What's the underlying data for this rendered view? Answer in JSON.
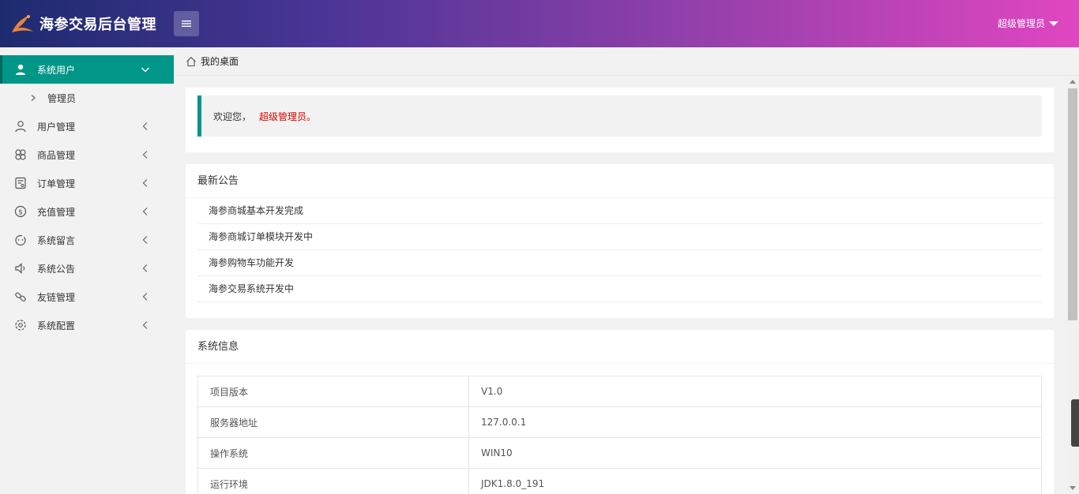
{
  "header": {
    "title": "海参交易后台管理",
    "user_menu": "超级管理员"
  },
  "sidebar": {
    "items": [
      {
        "label": "系统用户",
        "icon": "user-icon",
        "expanded": true,
        "sub": [
          "管理员"
        ]
      },
      {
        "label": "用户管理",
        "icon": "user-outline-icon"
      },
      {
        "label": "商品管理",
        "icon": "product-icon"
      },
      {
        "label": "订单管理",
        "icon": "order-icon"
      },
      {
        "label": "充值管理",
        "icon": "dollar-icon"
      },
      {
        "label": "系统留言",
        "icon": "message-icon"
      },
      {
        "label": "系统公告",
        "icon": "speaker-icon"
      },
      {
        "label": "友链管理",
        "icon": "link-icon"
      },
      {
        "label": "系统配置",
        "icon": "settings-icon"
      }
    ]
  },
  "breadcrumb": {
    "label": "我的桌面"
  },
  "welcome": {
    "text": "欢迎您，",
    "admin": "超级管理员。"
  },
  "notice": {
    "title": "最新公告",
    "items": [
      "海参商城基本开发完成",
      "海参商城订单模块开发中",
      "海参购物车功能开发",
      "海参交易系统开发中"
    ]
  },
  "sysinfo": {
    "title": "系统信息",
    "rows": [
      {
        "key": "项目版本",
        "value": "V1.0"
      },
      {
        "key": "服务器地址",
        "value": "127.0.0.1"
      },
      {
        "key": "操作系统",
        "value": "WIN10"
      },
      {
        "key": "运行环境",
        "value": "JDK1.8.0_191"
      }
    ]
  },
  "colors": {
    "accent": "#009688",
    "admin_text": "#dd0000"
  }
}
